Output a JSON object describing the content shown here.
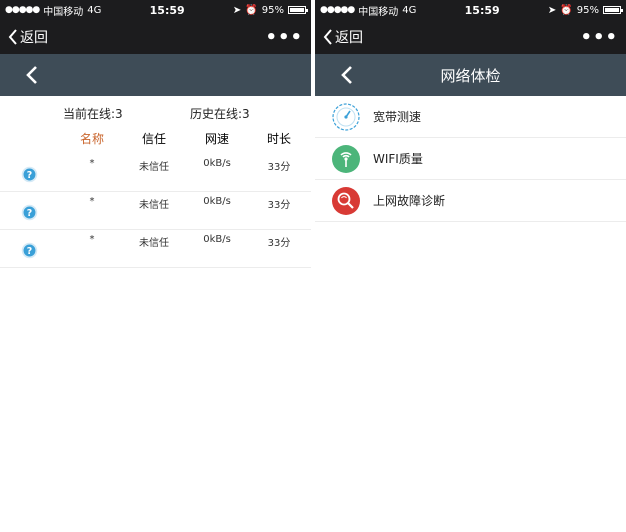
{
  "status": {
    "carrier": "中国移动",
    "network": "4G",
    "time": "15:59",
    "battery": "95%",
    "battery_level": 0.95
  },
  "wechat": {
    "back_label": "返回",
    "more_label": "•••"
  },
  "left": {
    "summary": {
      "current_online": "当前在线:3",
      "history_online": "历史在线:3"
    },
    "columns": {
      "name": "名称",
      "trust": "信任",
      "speed": "网速",
      "duration": "时长"
    },
    "rows": [
      {
        "name": "*",
        "trust": "未信任",
        "speed": "0kB/s",
        "duration": "33分"
      },
      {
        "name": "*",
        "trust": "未信任",
        "speed": "0kB/s",
        "duration": "33分"
      },
      {
        "name": "*",
        "trust": "未信任",
        "speed": "0kB/s",
        "duration": "33分"
      }
    ],
    "colors": {
      "name_header": "#c9642b",
      "header_bg": "#3e4c57"
    }
  },
  "right": {
    "title": "网络体检",
    "items": [
      {
        "label": "宽带测速",
        "icon": "speedometer-icon"
      },
      {
        "label": "WIFI质量",
        "icon": "wifi-signal-icon"
      },
      {
        "label": "上网故障诊断",
        "icon": "diagnosis-magnifier-icon"
      }
    ],
    "colors": {
      "wifi_green": "#4cb57a",
      "diagnosis_red": "#d83a35"
    }
  }
}
